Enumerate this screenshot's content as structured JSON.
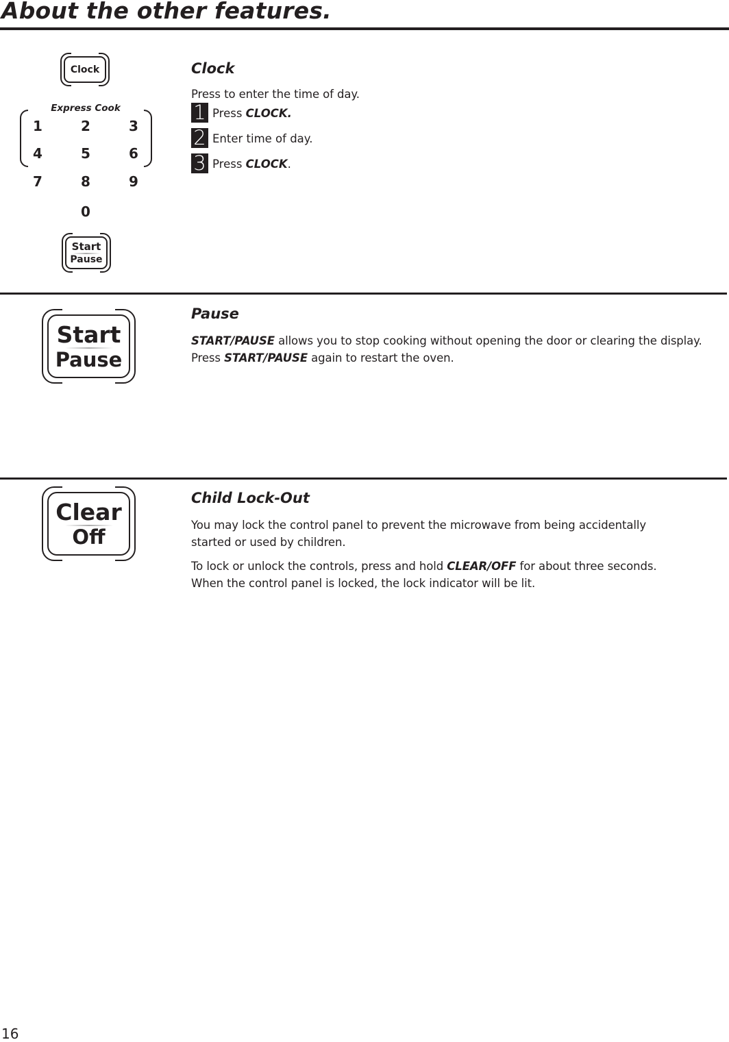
{
  "page": {
    "title": "About the other features.",
    "page_number": "16"
  },
  "sections": {
    "clock": {
      "heading": "Clock",
      "intro": "Press to enter the time of day.",
      "steps": [
        {
          "num": "1",
          "text": "Press ",
          "bold": "CLOCK.",
          "suffix": ""
        },
        {
          "num": "2",
          "text": "Enter time of day.",
          "bold": "",
          "suffix": ""
        },
        {
          "num": "3",
          "text": "Press ",
          "bold": "CLOCK",
          "suffix": "."
        }
      ],
      "illustration": {
        "clock_key": "Clock",
        "keypad_label": "Express Cook",
        "digits": [
          "1",
          "2",
          "3",
          "4",
          "5",
          "6",
          "7",
          "8",
          "9",
          "0"
        ],
        "start_key_top": "Start",
        "start_key_bottom": "Pause"
      }
    },
    "pause": {
      "heading": "Pause",
      "line1_bold": "START/PAUSE",
      "line1_rest": " allows you to stop cooking without opening the door or clearing the display.",
      "line2_pre": "Press ",
      "line2_bold": "START/PAUSE",
      "line2_rest": " again to restart the oven.",
      "illustration": {
        "key_top": "Start",
        "key_bottom": "Pause"
      }
    },
    "child_lock": {
      "heading": "Child Lock-Out",
      "para1_line1": "You may lock the control panel to prevent the microwave from being accidentally",
      "para1_line2": "started or used by children.",
      "para2_pre": "To lock or unlock the controls, press and hold ",
      "para2_bold": "CLEAR/OFF",
      "para2_rest": " for about three seconds.",
      "para2_line2": "When the control panel is locked, the lock indicator will be lit.",
      "illustration": {
        "key_top": "Clear",
        "key_bottom": "Off"
      }
    }
  }
}
